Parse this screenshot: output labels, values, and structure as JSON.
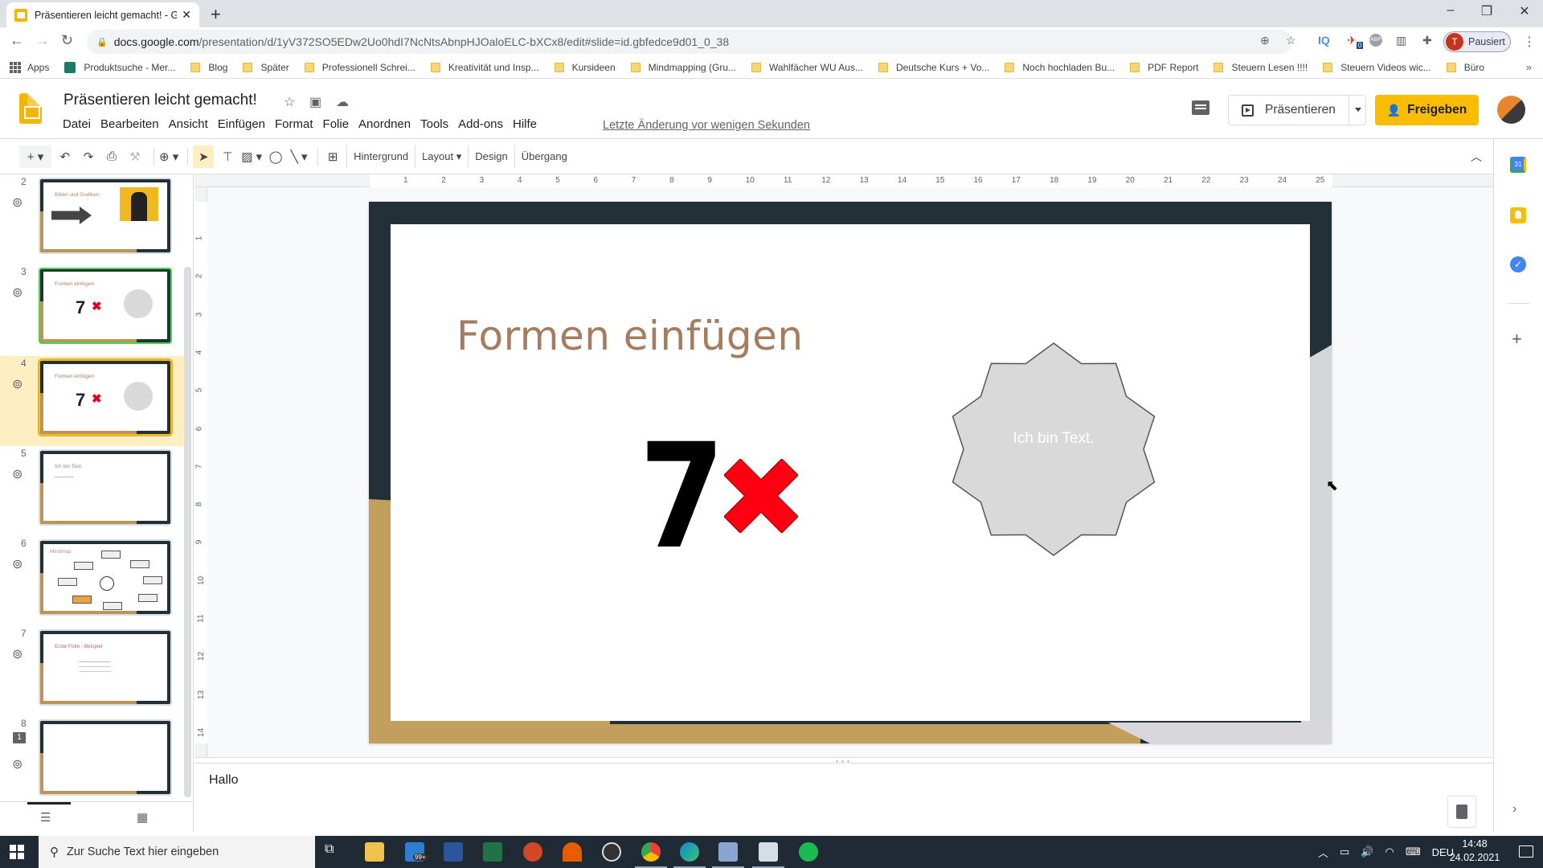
{
  "browser": {
    "tab_title": "Präsentieren leicht gemacht! - Go",
    "url_host": "docs.google.com",
    "url_path": "/presentation/d/1yV372SO5EDw2Uo0hdI7NcNtsAbnpHJOaloELC-bXCx8/edit#slide=id.gbfedce9d01_0_38",
    "profile_initial": "T",
    "profile_status": "Pausiert",
    "extension_badge": "0",
    "bookmarks": [
      {
        "label": "Apps",
        "icon": "apps-grid-icon"
      },
      {
        "label": "Produktsuche - Mer...",
        "icon": "site-favicon"
      },
      {
        "label": "Blog",
        "icon": "folder-icon"
      },
      {
        "label": "Später",
        "icon": "folder-icon"
      },
      {
        "label": "Professionell Schrei...",
        "icon": "folder-icon"
      },
      {
        "label": "Kreativität und Insp...",
        "icon": "folder-icon"
      },
      {
        "label": "Kursideen",
        "icon": "folder-icon"
      },
      {
        "label": "Mindmapping  (Gru...",
        "icon": "folder-icon"
      },
      {
        "label": "Wahlfächer WU Aus...",
        "icon": "folder-icon"
      },
      {
        "label": "Deutsche Kurs + Vo...",
        "icon": "folder-icon"
      },
      {
        "label": "Noch hochladen Bu...",
        "icon": "folder-icon"
      },
      {
        "label": "PDF Report",
        "icon": "folder-icon"
      },
      {
        "label": "Steuern Lesen !!!!",
        "icon": "folder-icon"
      },
      {
        "label": "Steuern Videos wic...",
        "icon": "folder-icon"
      },
      {
        "label": "Büro",
        "icon": "folder-icon"
      }
    ],
    "bookmarks_more": "»"
  },
  "doc": {
    "title": "Präsentieren leicht gemacht!",
    "menu": [
      "Datei",
      "Bearbeiten",
      "Ansicht",
      "Einfügen",
      "Format",
      "Folie",
      "Anordnen",
      "Tools",
      "Add-ons",
      "Hilfe"
    ],
    "last_edit": "Letzte Änderung vor wenigen Sekunden",
    "present_label": "Präsentieren",
    "share_label": "Freigeben"
  },
  "toolbar": {
    "background": "Hintergrund",
    "layout": "Layout",
    "design": "Design",
    "transition": "Übergang"
  },
  "filmstrip": {
    "slides": [
      {
        "number": "2",
        "title": "Bilder und Grafiken",
        "state": "normal"
      },
      {
        "number": "3",
        "title": "Formen einfügen",
        "state": "hover"
      },
      {
        "number": "4",
        "title": "Formen einfügen",
        "state": "selected"
      },
      {
        "number": "5",
        "title": "Ich bin Text.",
        "state": "normal"
      },
      {
        "number": "6",
        "title": "Mindmap",
        "state": "normal"
      },
      {
        "number": "7",
        "title": "Erste Folie - Beispiel",
        "state": "normal"
      },
      {
        "number": "8",
        "title": "",
        "state": "normal",
        "comments": "1"
      }
    ]
  },
  "rulers": {
    "horizontal": [
      "1",
      "2",
      "3",
      "4",
      "5",
      "6",
      "7",
      "8",
      "9",
      "10",
      "11",
      "12",
      "13",
      "14",
      "15",
      "16",
      "17",
      "18",
      "19",
      "20",
      "21",
      "22",
      "23",
      "24",
      "25"
    ],
    "vertical": [
      "1",
      "2",
      "3",
      "4",
      "5",
      "6",
      "7",
      "8",
      "9",
      "10",
      "11",
      "12",
      "13",
      "14"
    ]
  },
  "slide": {
    "title": "Formen einfügen",
    "number_text": "7",
    "shape_text": "Ich bin Text.",
    "colors": {
      "frame_dark": "#223038",
      "frame_gold": "#c29f5c",
      "title": "#a67c5e",
      "cross": "#ff0013",
      "star_fill": "#d9d9d9"
    }
  },
  "notes": {
    "text": "Hallo"
  },
  "taskbar": {
    "search_placeholder": "Zur Suche Text hier eingeben",
    "mail_badge": "99+",
    "language": "DEU",
    "time": "14:48",
    "date": "24.02.2021"
  }
}
